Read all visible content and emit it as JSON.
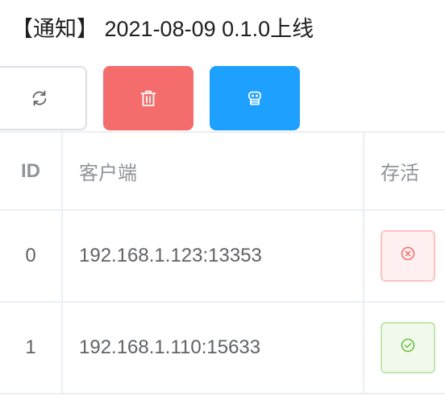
{
  "notice": {
    "prefix": "【通知】",
    "text": " 2021-08-09 0.1.0上线"
  },
  "toolbar": {
    "refresh_icon": "refresh-icon",
    "delete_icon": "trash-icon",
    "robot_icon": "robot-icon",
    "colors": {
      "delete": "#f56c6c",
      "robot": "#1ea0ff"
    }
  },
  "table": {
    "columns": [
      "ID",
      "客户端",
      "存活"
    ],
    "rows": [
      {
        "id": "0",
        "client": "192.168.1.123:13353",
        "alive": false,
        "status_icon": "circle-x-icon"
      },
      {
        "id": "1",
        "client": "192.168.1.110:15633",
        "alive": true,
        "status_icon": "circle-check-icon"
      }
    ]
  },
  "colors": {
    "danger": "#f56c6c",
    "success": "#67c23a"
  }
}
